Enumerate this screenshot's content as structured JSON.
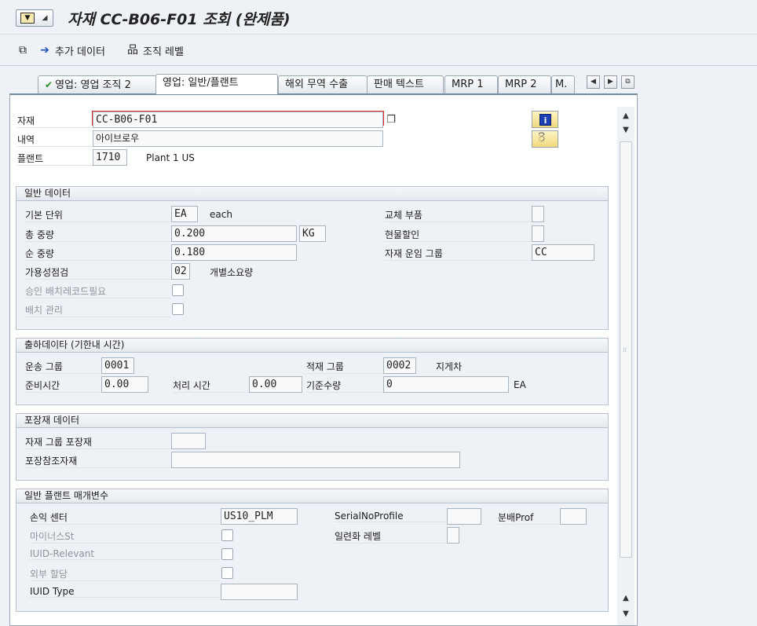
{
  "window": {
    "title": "자재 CC-B06-F01 조회 (완제품)"
  },
  "toolbar": {
    "items": [
      {
        "icon": "other-view-icon",
        "label": ""
      },
      {
        "icon": "arrow-right-icon",
        "label": "추가 데이터"
      },
      {
        "icon": "org-hierarchy-icon",
        "label": "조직 레벨"
      }
    ]
  },
  "tabs": [
    {
      "label": "영업: 영업 조직 2",
      "active": false
    },
    {
      "label": "영업: 일반/플랜트",
      "active": true
    },
    {
      "label": "해외 무역 수출",
      "active": false
    },
    {
      "label": "판매 텍스트",
      "active": false
    },
    {
      "label": "MRP 1",
      "active": false
    },
    {
      "label": "MRP 2",
      "active": false
    },
    {
      "label": "M.",
      "active": false
    }
  ],
  "header": {
    "material_label": "자재",
    "material_value": "CC-B06-F01",
    "description_label": "내역",
    "description_value": "아이브로우",
    "plant_label": "플랜트",
    "plant_value": "1710",
    "plant_name": "Plant 1 US"
  },
  "general_data": {
    "title": "일반 데이터",
    "base_unit_label": "기본 단위",
    "base_unit_value": "EA",
    "base_unit_text": "each",
    "gross_weight_label": "총 중량",
    "gross_weight_value": "0.200",
    "weight_unit": "KG",
    "net_weight_label": "순 중량",
    "net_weight_value": "0.180",
    "availability_label": "가용성점검",
    "availability_value": "02",
    "availability_text": "개별소요량",
    "approved_batch_label": "승인 배치레코드필요",
    "batch_mgmt_label": "배치 관리",
    "replacement_label": "교체 부품",
    "cash_discount_label": "현물할인",
    "transport_group_label": "자재 운임 그룹",
    "transport_group_value": "CC"
  },
  "shipping_data": {
    "title": "출하데이타 (기한내 시간)",
    "trans_group_label": "운송 그룹",
    "trans_group_value": "0001",
    "loading_group_label": "적재 그룹",
    "loading_group_value": "0002",
    "loading_group_text": "지게차",
    "setup_time_label": "준비시간",
    "setup_time_value": "0.00",
    "proc_time_label": "처리 시간",
    "proc_time_value": "0.00",
    "base_qty_label": "기준수량",
    "base_qty_value": "0",
    "base_qty_unit": "EA"
  },
  "packaging_data": {
    "title": "포장재 데이터",
    "matl_grp_pack_label": "자재 그룹 포장재",
    "ref_mat_label": "포장참조자재"
  },
  "plant_params": {
    "title": "일반 플랜트 매개변수",
    "profit_center_label": "손익 센터",
    "profit_center_value": "US10_PLM",
    "serial_profile_label": "SerialNoProfile",
    "distr_prof_label": "분배Prof",
    "minus_label": "마이너스St",
    "serial_level_label": "일련화 레벨",
    "iuid_relevant_label": "IUID-Relevant",
    "ext_alloc_label": "외부 할당",
    "iuid_type_label": "IUID Type"
  }
}
